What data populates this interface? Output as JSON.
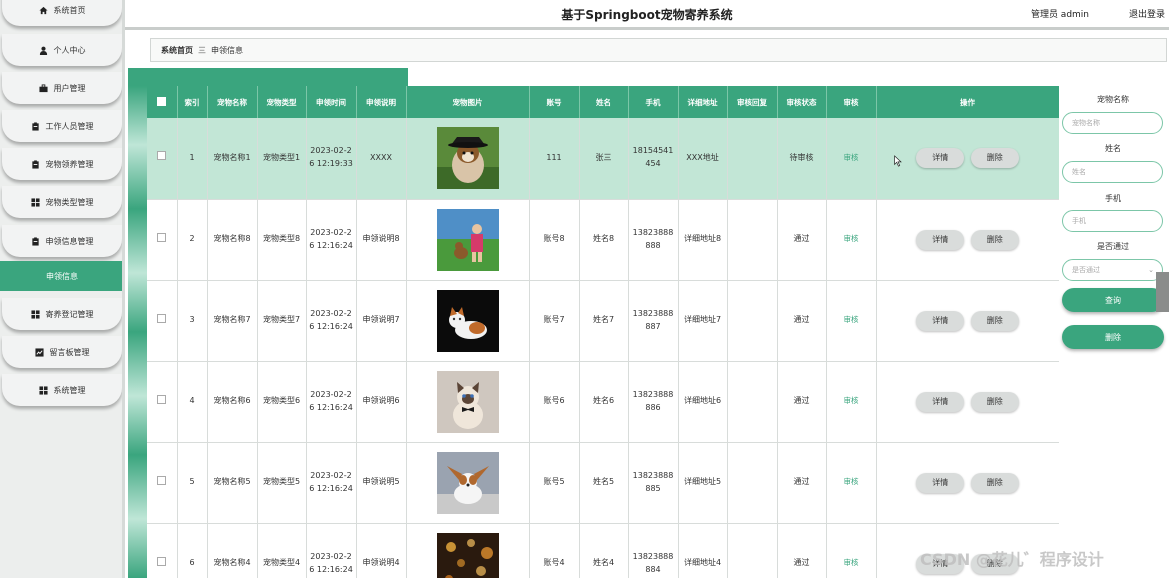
{
  "app": {
    "title": "基于Springboot宠物寄养系统",
    "user_role": "管理员 admin",
    "logout": "退出登录"
  },
  "sidebar": {
    "items": [
      {
        "label": "系统首页",
        "icon": "home-icon",
        "active": false
      },
      {
        "label": "个人中心",
        "icon": "person-icon",
        "active": false
      },
      {
        "label": "用户管理",
        "icon": "briefcase-icon",
        "active": false
      },
      {
        "label": "工作人员管理",
        "icon": "clipboard-icon",
        "active": false
      },
      {
        "label": "宠物领养管理",
        "icon": "clipboard-icon",
        "active": false
      },
      {
        "label": "宠物类型管理",
        "icon": "grid-icon",
        "active": false
      },
      {
        "label": "申领信息管理",
        "icon": "clipboard-icon",
        "active": false
      },
      {
        "label": "申领信息",
        "icon": "",
        "active": true
      },
      {
        "label": "寄养登记管理",
        "icon": "grid-icon",
        "active": false
      },
      {
        "label": "留言板管理",
        "icon": "board-icon",
        "active": false
      },
      {
        "label": "系统管理",
        "icon": "grid-icon",
        "active": false
      }
    ]
  },
  "breadcrumb": {
    "home": "系统首页",
    "separator": "三",
    "current": "申领信息"
  },
  "table": {
    "headers": [
      "索引",
      "宠物名称",
      "宠物类型",
      "申领时间",
      "申领说明",
      "宠物图片",
      "账号",
      "姓名",
      "手机",
      "详细地址",
      "审核回复",
      "审核状态",
      "审核",
      "操作"
    ],
    "rows": [
      {
        "index": "1",
        "name": "宠物名称1",
        "type": "宠物类型1",
        "time": "2023-02-26 12:19:33",
        "desc": "XXXX",
        "image": "dog-with-hat",
        "account": "111",
        "person": "张三",
        "phone": "18154541454",
        "address": "XXX地址",
        "reply": "",
        "status": "待审核",
        "audit": "审核",
        "detail": "详情",
        "delete": "删除",
        "highlight": true
      },
      {
        "index": "2",
        "name": "宠物名称8",
        "type": "宠物类型8",
        "time": "2023-02-26 12:16:24",
        "desc": "申领说明8",
        "image": "girl-with-dog",
        "account": "账号8",
        "person": "姓名8",
        "phone": "13823888888",
        "address": "详细地址8",
        "reply": "",
        "status": "通过",
        "audit": "审核",
        "detail": "详情",
        "delete": "删除",
        "highlight": false
      },
      {
        "index": "3",
        "name": "宠物名称7",
        "type": "宠物类型7",
        "time": "2023-02-26 12:16:24",
        "desc": "申领说明7",
        "image": "cat-on-black",
        "account": "账号7",
        "person": "姓名7",
        "phone": "13823888887",
        "address": "详细地址7",
        "reply": "",
        "status": "通过",
        "audit": "审核",
        "detail": "详情",
        "delete": "删除",
        "highlight": false
      },
      {
        "index": "4",
        "name": "宠物名称6",
        "type": "宠物类型6",
        "time": "2023-02-26 12:16:24",
        "desc": "申领说明6",
        "image": "cat-bowtie",
        "account": "账号6",
        "person": "姓名6",
        "phone": "13823888886",
        "address": "详细地址6",
        "reply": "",
        "status": "通过",
        "audit": "审核",
        "detail": "详情",
        "delete": "删除",
        "highlight": false
      },
      {
        "index": "5",
        "name": "宠物名称5",
        "type": "宠物类型5",
        "time": "2023-02-26 12:16:24",
        "desc": "申领说明5",
        "image": "papillon-dog",
        "account": "账号5",
        "person": "姓名5",
        "phone": "13823888885",
        "address": "详细地址5",
        "reply": "",
        "status": "通过",
        "audit": "审核",
        "detail": "详情",
        "delete": "删除",
        "highlight": false
      },
      {
        "index": "6",
        "name": "宠物名称4",
        "type": "宠物类型4",
        "time": "2023-02-26 12:16:24",
        "desc": "申领说明4",
        "image": "night-lights",
        "account": "账号4",
        "person": "姓名4",
        "phone": "13823888884",
        "address": "详细地址4",
        "reply": "",
        "status": "通过",
        "audit": "审核",
        "detail": "详情",
        "delete": "删除",
        "highlight": false
      }
    ]
  },
  "search": {
    "pet_name_label": "宠物名称",
    "pet_name_placeholder": "宠物名称",
    "name_label": "姓名",
    "name_placeholder": "姓名",
    "phone_label": "手机",
    "phone_placeholder": "手机",
    "approved_label": "是否通过",
    "approved_placeholder": "是否通过",
    "query_button": "查询",
    "delete_button": "删除"
  },
  "watermark": "CSDN @花儿゛程序设计",
  "colors": {
    "accent": "#3aa57e",
    "highlight_row": "#c2e6d6",
    "sidebar_bg": "#eceeed"
  }
}
